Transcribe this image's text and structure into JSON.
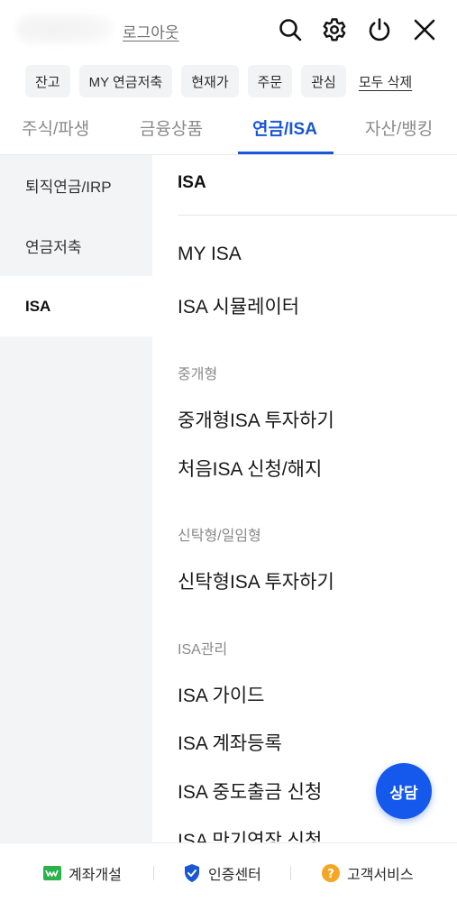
{
  "header": {
    "logout_label": "로그아웃",
    "icons": [
      "search-icon",
      "gear-icon",
      "power-icon",
      "close-icon"
    ]
  },
  "quick_chips": [
    "잔고",
    "MY 연금저축",
    "현재가",
    "주문",
    "관심"
  ],
  "quick_delete_all": "모두 삭제",
  "tabs": [
    {
      "label": "주식/파생",
      "active": false
    },
    {
      "label": "금융상품",
      "active": false
    },
    {
      "label": "연금/ISA",
      "active": true
    },
    {
      "label": "자산/뱅킹",
      "active": false
    }
  ],
  "left_nav": [
    {
      "label": "퇴직연금/IRP",
      "active": false
    },
    {
      "label": "연금저축",
      "active": false
    },
    {
      "label": "ISA",
      "active": true
    }
  ],
  "content": {
    "title": "ISA",
    "items_top": [
      "MY ISA",
      "ISA 시뮬레이터"
    ],
    "groups": [
      {
        "label": "중개형",
        "items": [
          "중개형ISA 투자하기",
          "처음ISA 신청/해지"
        ]
      },
      {
        "label": "신탁형/일임형",
        "items": [
          "신탁형ISA 투자하기"
        ]
      },
      {
        "label": "ISA관리",
        "items": [
          "ISA 가이드",
          "ISA 계좌등록",
          "ISA 중도출금 신청",
          "ISA 만기연장 신청"
        ]
      }
    ]
  },
  "floating_button": "상담",
  "bottom_bar": [
    {
      "label": "계좌개설",
      "icon": "account-open-icon"
    },
    {
      "label": "인증센터",
      "icon": "shield-check-icon"
    },
    {
      "label": "고객서비스",
      "icon": "help-icon"
    }
  ],
  "colors": {
    "accent": "#1a56d6",
    "consult": "#1558ec",
    "nav_bg": "#f3f4f6",
    "help": "#f5a623",
    "account": "#2bb24c"
  }
}
